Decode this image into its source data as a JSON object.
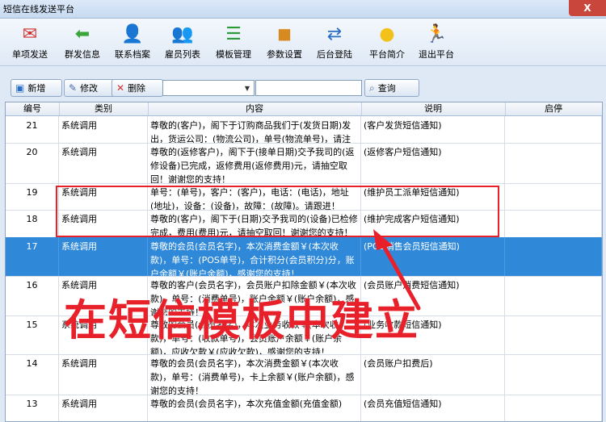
{
  "window": {
    "title": "短信在线发送平台",
    "close_label": "X"
  },
  "toolbar": [
    {
      "label": "单项发送",
      "icon": "envelope-icon",
      "glyph": "✉",
      "color": "#d22f2f"
    },
    {
      "label": "群发信息",
      "icon": "arrow-left-icon",
      "glyph": "⬅",
      "color": "#3aa63a"
    },
    {
      "label": "联系档案",
      "icon": "contact-icon",
      "glyph": "👤",
      "color": "#c45a2a"
    },
    {
      "label": "雇员列表",
      "icon": "staff-icon",
      "glyph": "👥",
      "color": "#2a6fc4"
    },
    {
      "label": "模板管理",
      "icon": "list-icon",
      "glyph": "☰",
      "color": "#2a9a3a"
    },
    {
      "label": "参数设置",
      "icon": "cubes-icon",
      "glyph": "◼",
      "color": "#d68a1f"
    },
    {
      "label": "后台登陆",
      "icon": "sync-icon",
      "glyph": "⇄",
      "color": "#2a6fc4"
    },
    {
      "label": "平台简介",
      "icon": "bulb-icon",
      "glyph": "●",
      "color": "#f2c21b"
    },
    {
      "label": "退出平台",
      "icon": "exit-icon",
      "glyph": "🏃",
      "color": "#3aa63a"
    }
  ],
  "actions": {
    "add": "新增",
    "edit": "修改",
    "delete": "删除",
    "combo_value": "",
    "search_value": "",
    "query": "查询"
  },
  "table": {
    "headers": [
      "编号",
      "类别",
      "内容",
      "说明",
      "启停"
    ],
    "rows": [
      {
        "id": "21",
        "type": "系统调用",
        "content": "尊敬的(客户)，阁下于订购商品我们于(发货日期)发出，货运公司：(物流公司)，单号(物流单号)，请注意查收！",
        "desc": "(客户发货短信通知)",
        "status": ""
      },
      {
        "id": "20",
        "type": "系统调用",
        "content": "尊敬的(返修客户)，阁下于(接单日期)交予我司的(返修设备)已完成，返修费用(返修费用)元，请抽空取回！谢谢您的支持！",
        "desc": "(返修客户短信通知)",
        "status": ""
      },
      {
        "id": "19",
        "type": "系统调用",
        "content": "单号：(单号)，客户：(客户)，电话：(电话)，地址(地址)，设备：(设备)，故障：(故障)。请跟进！",
        "desc": "(维护员工派单短信通知)",
        "status": ""
      },
      {
        "id": "18",
        "type": "系统调用",
        "content": "尊敬的(客户)，阁下于(日期)交予我司的(设备)已检修完成，费用(费用)元，请抽空取回！谢谢您的支持！",
        "desc": "(维护完成客户短信通知)",
        "status": ""
      },
      {
        "id": "17",
        "type": "系统调用",
        "content": "尊敬的会员(会员名字)，本次消费金额￥(本次收款)，单号：(POS单号)，合计积分(会员积分)分，账户余额￥(账户余额)，感谢您的支持！",
        "desc": "(POS销售会员短信通知)",
        "status": ""
      },
      {
        "id": "16",
        "type": "系统调用",
        "content": "尊敬的客户(会员名字)，会员账户扣除金额￥(本次收款)，单号：(消费单号)，账户余额￥(账户余额)，感谢您的支持！",
        "desc": "(会员账户消费短信通知)",
        "status": ""
      },
      {
        "id": "15",
        "type": "系统调用",
        "content": "尊敬的会员(会员名字)，本次业务收款￥(本次收款)，单号：(收款单号)，会员账户余额￥(账户余额)，应收欠款￥(应收欠款)，感谢您的支持！",
        "desc": "(业务收款短信通知)",
        "status": ""
      },
      {
        "id": "14",
        "type": "系统调用",
        "content": "尊敬的会员(会员名字)，本次消费金额￥(本次收款)，单号：(消费单号)，卡上余额￥(账户余额)，感谢您的支持！",
        "desc": "(会员账户扣费后)",
        "status": ""
      },
      {
        "id": "13",
        "type": "系统调用",
        "content": "尊敬的会员(会员名字)，本次充值金额(充值金额)",
        "desc": "(会员充值短信通知)",
        "status": ""
      }
    ]
  },
  "annotation": {
    "text": "在短信模板中建立",
    "color": "#e8202a"
  }
}
